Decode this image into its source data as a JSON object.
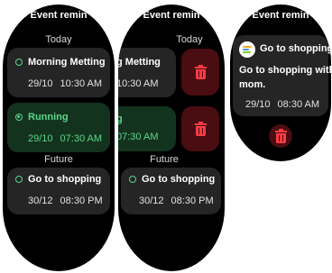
{
  "app_title": "Event remin",
  "sections": {
    "today": "Today",
    "future": "Future"
  },
  "events": [
    {
      "title": "Morning Metting",
      "date": "29/10",
      "time": "10:30 AM"
    },
    {
      "title": "Running",
      "date": "29/10",
      "time": "07:30 AM"
    },
    {
      "title": "Go to shopping",
      "date": "30/12",
      "time": "08:30 PM"
    }
  ],
  "swiped": [
    {
      "title": "g Metting",
      "time": "10:30 AM"
    },
    {
      "title": "g",
      "time": "07:30 AM"
    }
  ],
  "detail": {
    "title": "Go to shopping",
    "description_line1": "Go to shopping with",
    "description_line2": "mom.",
    "date": "29/10",
    "time": "08:30 AM"
  },
  "colors": {
    "accent_green": "#59d68a",
    "delete_red": "#ff3b45",
    "delete_bg": "#4a0d12",
    "card_bg": "#252525",
    "active_card_bg": "#14331e"
  },
  "icons": [
    "radio-icon",
    "trash-icon",
    "app-icon"
  ]
}
